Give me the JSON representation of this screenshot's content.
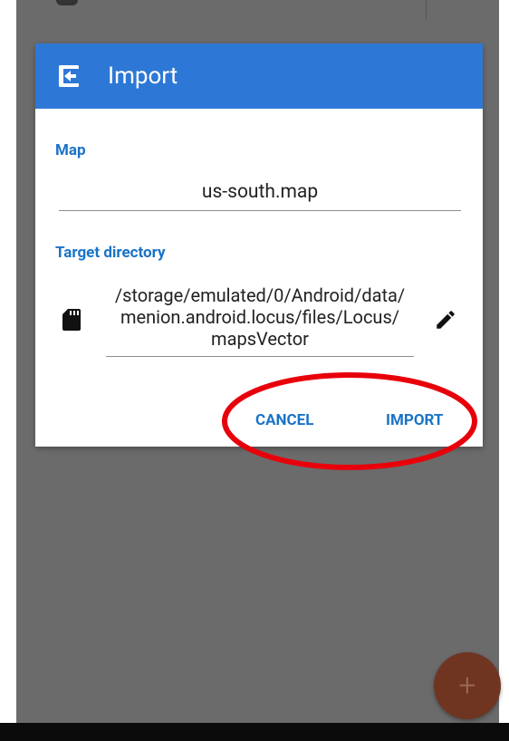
{
  "dialog": {
    "title": "Import",
    "icon": "import-icon",
    "map_label": "Map",
    "map_value": "us-south.map",
    "target_label": "Target directory",
    "target_path": "/storage/emulated/0/Android/data/menion.android.locus/files/Locus/mapsVector",
    "target_path_lines": [
      "/storage/emulated/0/Android/data/",
      "menion.android.locus/files/Locus/",
      "mapsVector"
    ],
    "storage_icon": "sd-card-icon",
    "edit_icon": "pencil-icon",
    "cancel_label": "CANCEL",
    "import_label": "IMPORT"
  },
  "fab": {
    "label": "+",
    "icon": "add-icon"
  },
  "colors": {
    "header": "#2d78d6",
    "accent": "#1a73c7",
    "scrim": "#6b6b6b",
    "fab": "#6f3521",
    "annotation": "#e8000b"
  }
}
